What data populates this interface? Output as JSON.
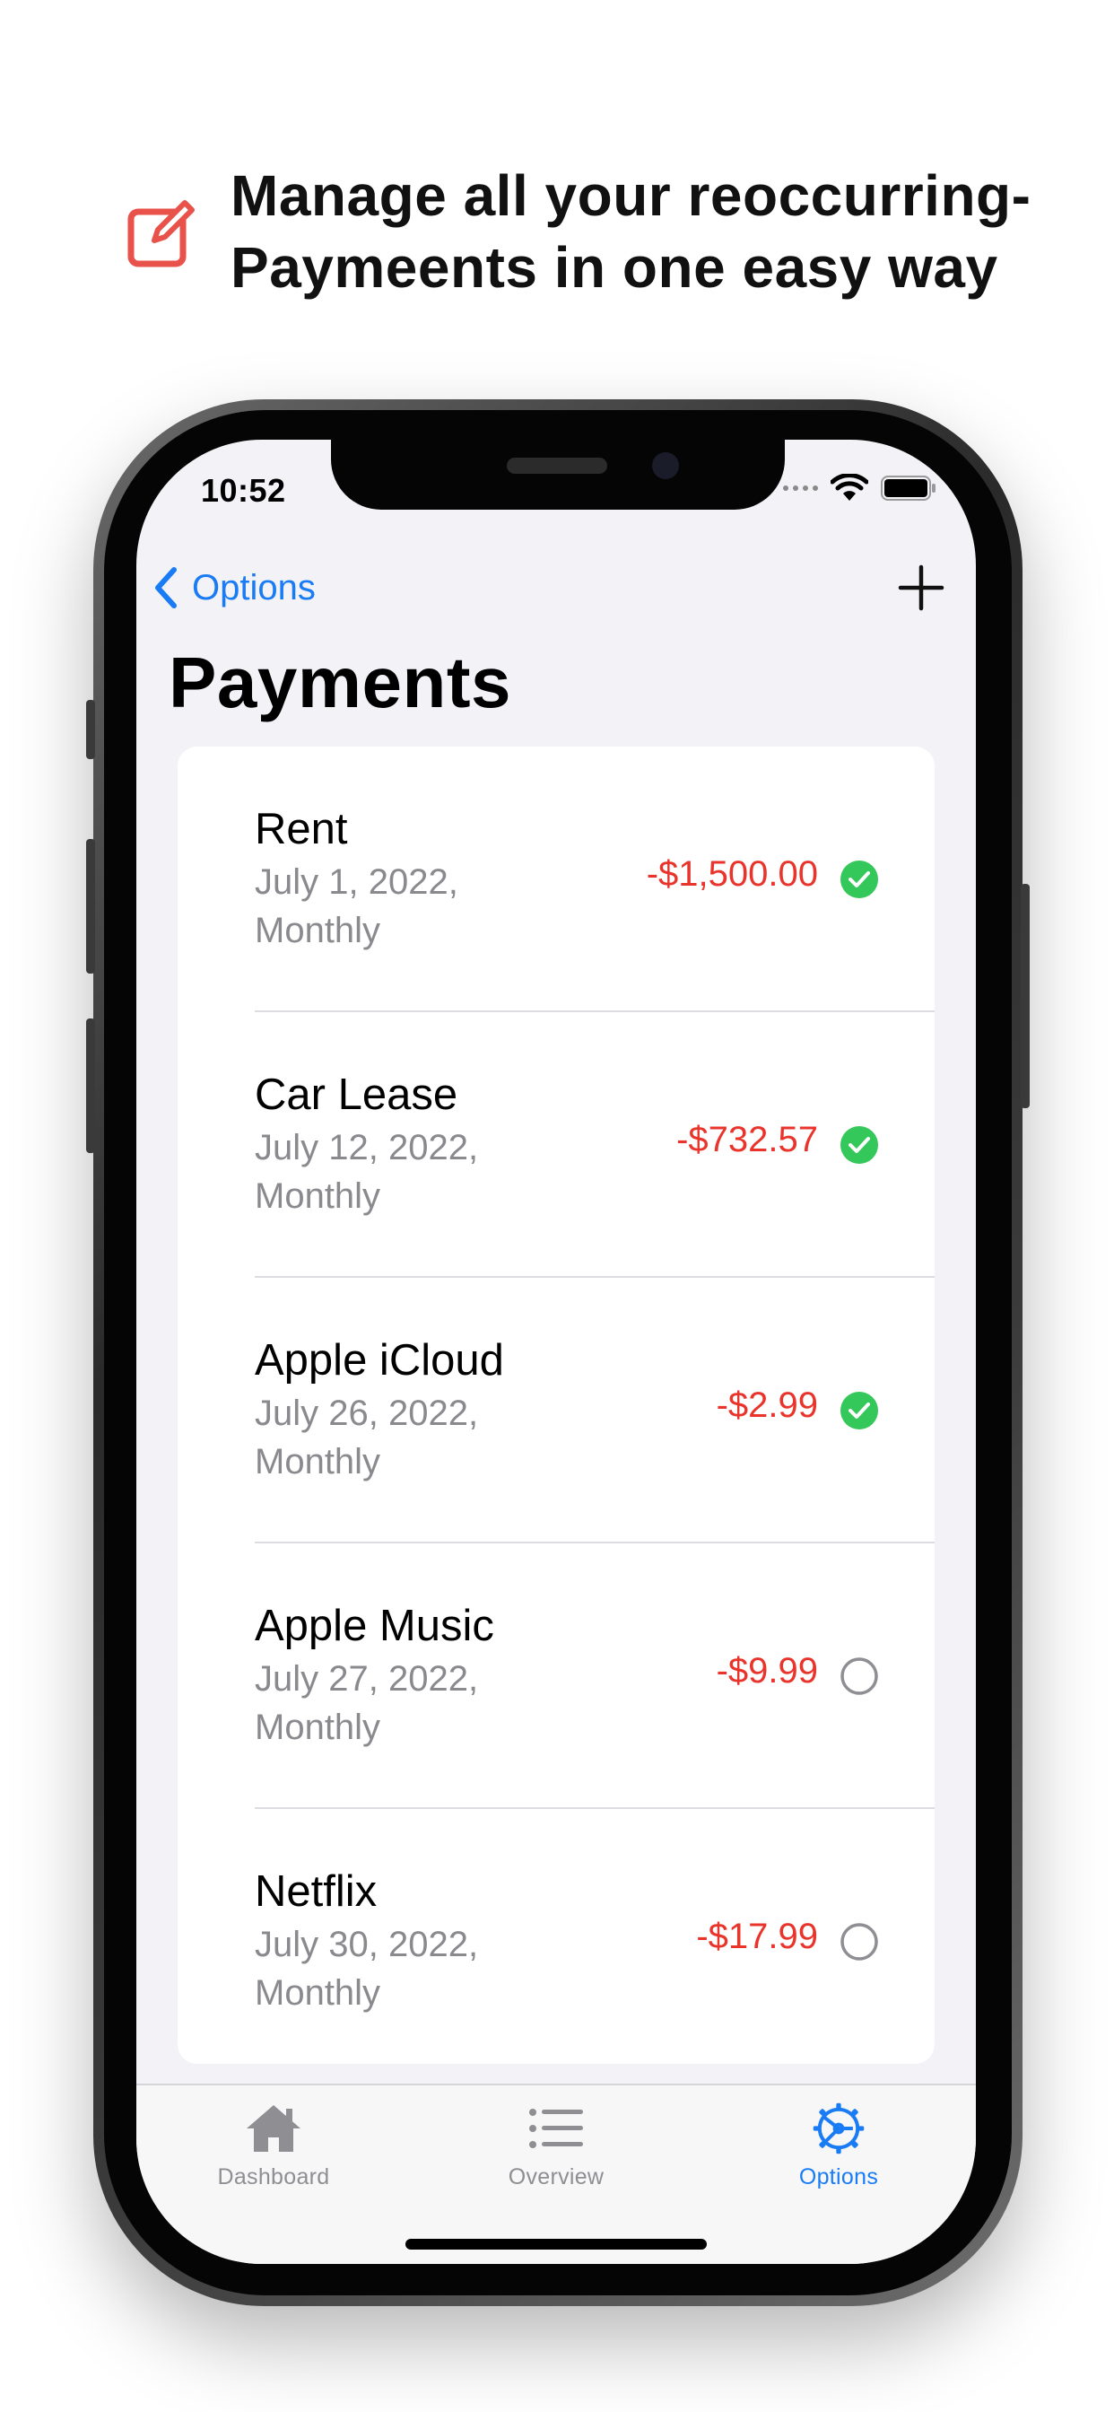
{
  "promo": {
    "icon": "compose-icon",
    "headline": "Manage all your reoccurring-\nPaymeents in one easy way",
    "accent_color": "#e9524a"
  },
  "status_bar": {
    "time": "10:52",
    "icons": [
      "signal-dots-icon",
      "wifi-icon",
      "battery-icon"
    ]
  },
  "nav": {
    "back_label": "Options",
    "back_icon": "chevron-left-icon",
    "add_icon": "plus-icon",
    "title": "Payments",
    "tint_color": "#1a7cf5"
  },
  "payments": [
    {
      "name": "Rent",
      "subtitle": "July 1, 2022,\nMonthly",
      "amount": "-$1,500.00",
      "paid": true
    },
    {
      "name": "Car Lease",
      "subtitle": "July 12, 2022,\nMonthly",
      "amount": "-$732.57",
      "paid": true
    },
    {
      "name": "Apple iCloud",
      "subtitle": "July 26, 2022,\nMonthly",
      "amount": "-$2.99",
      "paid": true
    },
    {
      "name": "Apple Music",
      "subtitle": "July 27, 2022,\nMonthly",
      "amount": "-$9.99",
      "paid": false
    },
    {
      "name": "Netflix",
      "subtitle": "July 30, 2022,\nMonthly",
      "amount": "-$17.99",
      "paid": false
    }
  ],
  "colors": {
    "amount": "#e9342c",
    "paid_check": "#34c759",
    "unpaid_circle": "#8e8e93"
  },
  "tabbar": {
    "tabs": [
      {
        "label": "Dashboard",
        "icon": "house-icon",
        "active": false
      },
      {
        "label": "Overview",
        "icon": "list-icon",
        "active": false
      },
      {
        "label": "Options",
        "icon": "gear-steering-icon",
        "active": true
      }
    ]
  }
}
